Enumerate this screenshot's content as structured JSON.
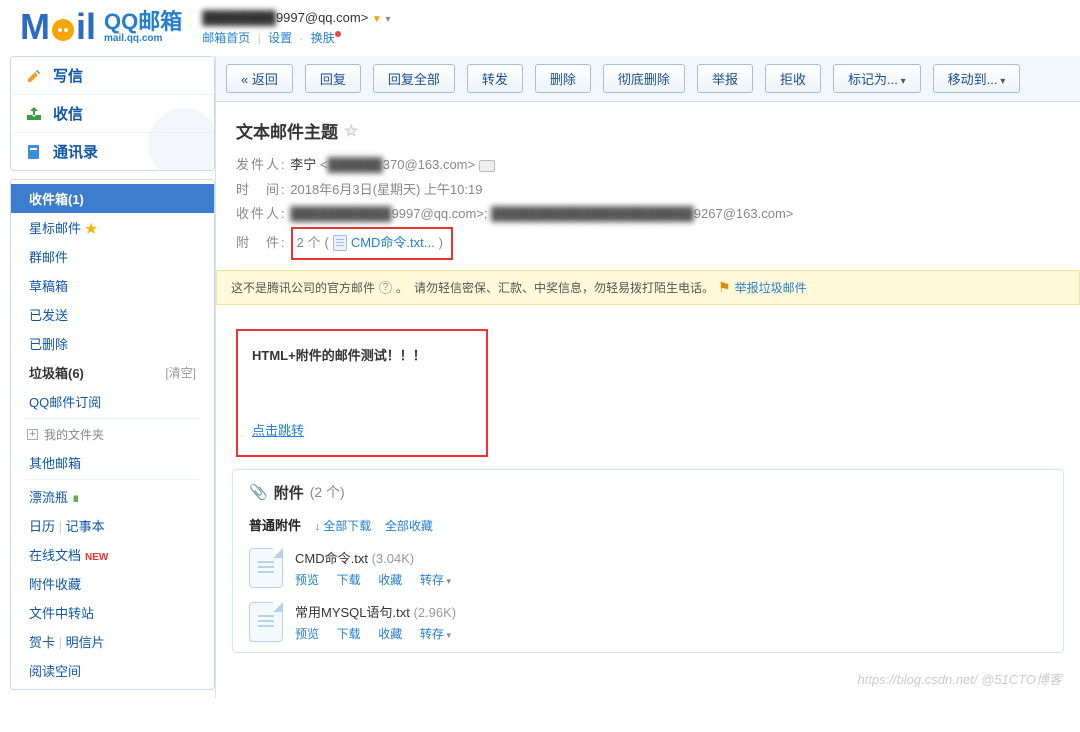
{
  "header": {
    "account_prefix_blur": "████████",
    "account_suffix": "9997@qq.com>",
    "nav_home": "邮箱首页",
    "nav_settings": "设置",
    "nav_skin": "换肤",
    "logo_cn": "QQ邮箱",
    "logo_sub": "mail.qq.com"
  },
  "sidebar": {
    "compose": "写信",
    "receive": "收信",
    "contacts": "通讯录",
    "inbox": "收件箱(1)",
    "star": "星标邮件",
    "group": "群邮件",
    "drafts": "草稿箱",
    "sent": "已发送",
    "deleted": "已删除",
    "trash": "垃圾箱(6)",
    "trash_clear": "[清空]",
    "qqsub": "QQ邮件订阅",
    "myfolder": "我的文件夹",
    "other": "其他邮箱",
    "drift": "漂流瓶",
    "calendar": "日历",
    "notes": "记事本",
    "docs": "在线文档",
    "attachfav": "附件收藏",
    "transfer": "文件中转站",
    "cards": "贺卡",
    "postcard": "明信片",
    "read": "阅读空间"
  },
  "toolbar": {
    "back": "返回",
    "reply": "回复",
    "replyall": "回复全部",
    "forward": "转发",
    "delete": "删除",
    "harddelete": "彻底删除",
    "report": "举报",
    "reject": "拒收",
    "mark": "标记为...",
    "move": "移动到..."
  },
  "mail": {
    "subject": "文本邮件主题",
    "from_label": "发件人:",
    "from_name": "李宁",
    "from_addr_blur": "██████",
    "from_addr_suffix": "370@163.com>",
    "time_label": "时　间:",
    "time_value": "2018年6月3日(星期天) 上午10:19",
    "to_label": "收件人:",
    "to1_blur": "███████████",
    "to1_suffix": "9997@qq.com>;",
    "to2_blur": "██████████████████████",
    "to2_suffix": "9267@163.com>",
    "att_label": "附　件:",
    "att_count_text": "2 个",
    "att_first": "CMD命令.txt...",
    "body_text": "HTML+附件的邮件测试！！！",
    "body_link": "点击跳转"
  },
  "notice": {
    "part1": "这不是腾讯公司的官方邮件",
    "part2": "。　请勿轻信密保、汇款、中奖信息，勿轻易拨打陌生电话。",
    "report": "举报垃圾邮件"
  },
  "attachments": {
    "title": "附件",
    "count": "(2 个)",
    "normal": "普通附件",
    "dl_all": "全部下载",
    "fav_all": "全部收藏",
    "items": [
      {
        "name": "CMD命令.txt",
        "size": "(3.04K)"
      },
      {
        "name": "常用MYSQL语句.txt",
        "size": "(2.96K)"
      }
    ],
    "act_preview": "预览",
    "act_download": "下载",
    "act_fav": "收藏",
    "act_saveto": "转存"
  },
  "watermark": "https://blog.csdn.net/  @51CTO博客"
}
